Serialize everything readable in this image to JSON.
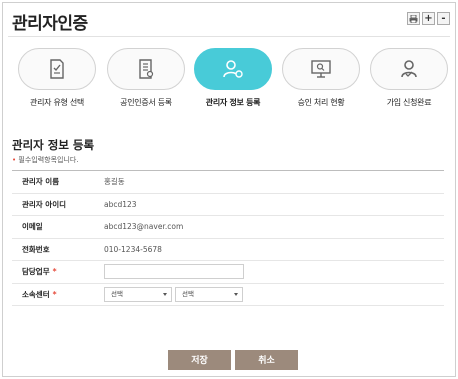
{
  "page": {
    "title": "관리자인증"
  },
  "tools": {
    "print_label": "",
    "zoom_in_label": "+",
    "zoom_out_label": "-"
  },
  "steps": [
    {
      "label": "관리자 유형 선택",
      "icon": "checklist-icon",
      "active": false
    },
    {
      "label": "공인인증서 등록",
      "icon": "certificate-document-icon",
      "active": false
    },
    {
      "label": "관리자 정보 등록",
      "icon": "user-edit-icon",
      "active": true
    },
    {
      "label": "승인 처리 현황",
      "icon": "monitor-search-icon",
      "active": false
    },
    {
      "label": "가입 신청완료",
      "icon": "user-check-icon",
      "active": false
    }
  ],
  "form": {
    "section_title": "관리자 정보 등록",
    "required_note_mark": "•",
    "required_note": "필수입력항목입니다.",
    "rows": {
      "name": {
        "label": "관리자 이름",
        "value": "홍길동"
      },
      "id": {
        "label": "관리자 아이디",
        "value": "abcd123"
      },
      "email": {
        "label": "이메일",
        "value": "abcd123@naver.com"
      },
      "phone": {
        "label": "전화번호",
        "value": "010-1234-5678"
      },
      "duty": {
        "label": "담당업무",
        "required_mark": "*",
        "value": ""
      },
      "center": {
        "label": "소속센터",
        "required_mark": "*",
        "select1": "선택",
        "select2": "선택"
      }
    }
  },
  "buttons": {
    "save": "저장",
    "cancel": "취소"
  },
  "colors": {
    "accent": "#48cbd8",
    "button": "#9c8a7c",
    "required": "#e64a3b"
  }
}
